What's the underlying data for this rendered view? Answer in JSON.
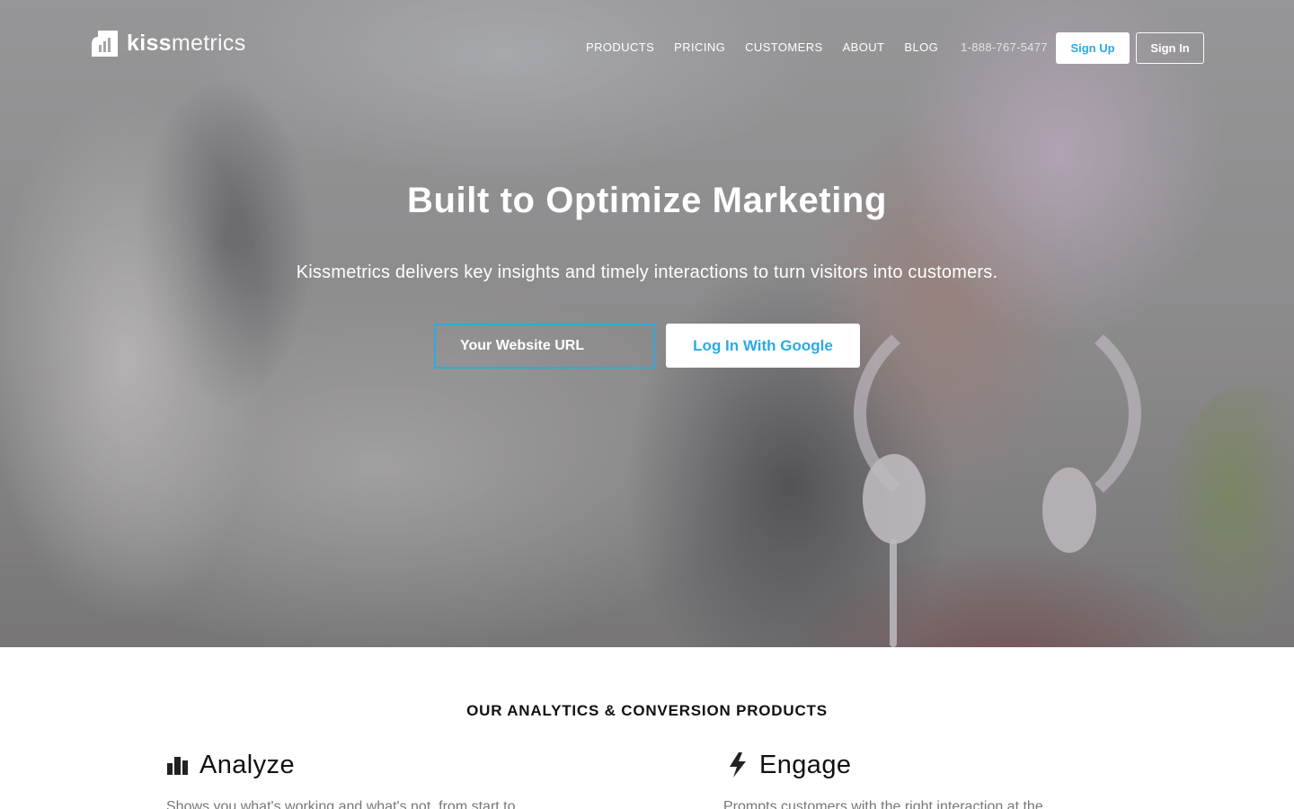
{
  "brand": {
    "logo_bold": "kiss",
    "logo_light": "metrics",
    "accent_color": "#29abe2"
  },
  "nav": {
    "links": [
      "PRODUCTS",
      "PRICING",
      "CUSTOMERS",
      "ABOUT",
      "BLOG"
    ],
    "phone": "1-888-767-5477",
    "signup_label": "Sign Up",
    "signin_label": "Sign In"
  },
  "hero": {
    "title": "Built to Optimize Marketing",
    "subtitle": "Kissmetrics delivers key insights and timely interactions to turn visitors into customers.",
    "url_placeholder": "Your Website URL",
    "google_button_label": "Log In With Google"
  },
  "products": {
    "heading": "OUR ANALYTICS & CONVERSION PRODUCTS",
    "items": [
      {
        "title": "Analyze",
        "icon": "bar-chart-icon",
        "description": "Shows you what's working and what's not, from start to"
      },
      {
        "title": "Engage",
        "icon": "lightning-bolt-icon",
        "description": "Prompts customers with the right interaction at the"
      }
    ]
  }
}
